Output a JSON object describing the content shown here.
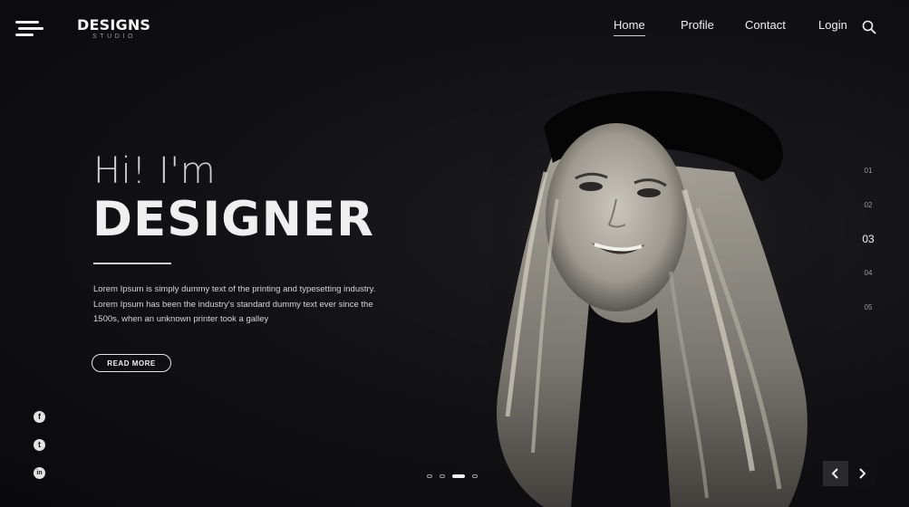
{
  "header": {
    "logo_main": "DESIGNS",
    "logo_sub": "STUDIO",
    "nav": [
      "Home",
      "Profile",
      "Contact",
      "Login"
    ]
  },
  "hero": {
    "greeting": "Hi! I'm",
    "title": "DESIGNER",
    "description": "Lorem Ipsum is simply dummy text of the printing and typesetting industry. Lorem Ipsum has been the industry's standard dummy text ever since the 1500s, when an unknown printer took a galley",
    "button_label": "READ MORE"
  },
  "social": [
    "f",
    "t",
    "in"
  ],
  "pagination": [
    "01",
    "02",
    "03",
    "04",
    "05"
  ],
  "pagination_active": "03",
  "slider": {
    "dot_count": 4,
    "active_dot": 3
  },
  "colors": {
    "background": "#0c0c0e",
    "text": "#efefef",
    "muted": "#9a9a9a"
  },
  "icons": [
    "menu-icon",
    "search-icon",
    "facebook-icon",
    "twitter-icon",
    "linkedin-icon",
    "chevron-left-icon",
    "chevron-right-icon"
  ]
}
